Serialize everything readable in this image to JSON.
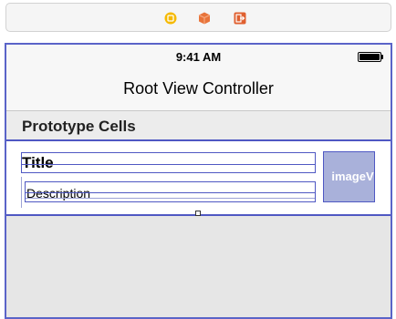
{
  "scene_dock": {
    "icons": [
      "view-controller-icon",
      "first-responder-icon",
      "exit-icon"
    ],
    "colors": {
      "view_controller": "#f5b900",
      "first_responder": "#e8743b",
      "exit": "#e06030"
    }
  },
  "status_bar": {
    "time": "9:41 AM",
    "battery": "full"
  },
  "nav_bar": {
    "title": "Root View Controller"
  },
  "table": {
    "section_header": "Prototype Cells",
    "cell": {
      "title": "Title",
      "description": "Description",
      "image_placeholder": "imageVi"
    }
  },
  "colors": {
    "selection": "#4f58c3",
    "image_view_bg": "#a9b1da",
    "canvas_bg": "#e6e6e6"
  }
}
